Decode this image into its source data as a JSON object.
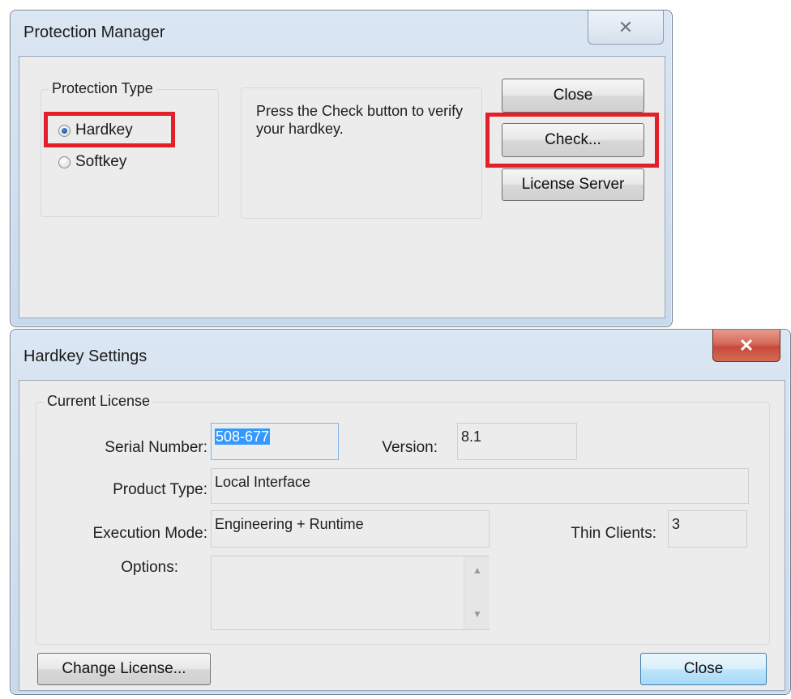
{
  "protection_manager": {
    "title": "Protection Manager",
    "close_glyph": "✕",
    "protection_type": {
      "label": "Protection Type",
      "options": [
        {
          "label": "Hardkey",
          "checked": true
        },
        {
          "label": "Softkey",
          "checked": false
        }
      ]
    },
    "message": "Press the Check button to verify your hardkey.",
    "buttons": {
      "close": "Close",
      "check": "Check...",
      "license_server": "License Server"
    }
  },
  "hardkey_settings": {
    "title": "Hardkey Settings",
    "close_glyph": "✕",
    "group_label": "Current License",
    "serial_number": {
      "label": "Serial Number:",
      "value": "508-677"
    },
    "version": {
      "label": "Version:",
      "value": "8.1"
    },
    "product_type": {
      "label": "Product Type:",
      "value": "Local Interface"
    },
    "execution_mode": {
      "label": "Execution Mode:",
      "value": "Engineering + Runtime"
    },
    "thin_clients": {
      "label": "Thin Clients:",
      "value": "3"
    },
    "options": {
      "label": "Options:",
      "value": ""
    },
    "buttons": {
      "change_license": "Change License...",
      "close": "Close"
    }
  },
  "colors": {
    "highlight": "#e3202a",
    "title_close_red": "#c74a3c",
    "selection": "#3399ff"
  }
}
